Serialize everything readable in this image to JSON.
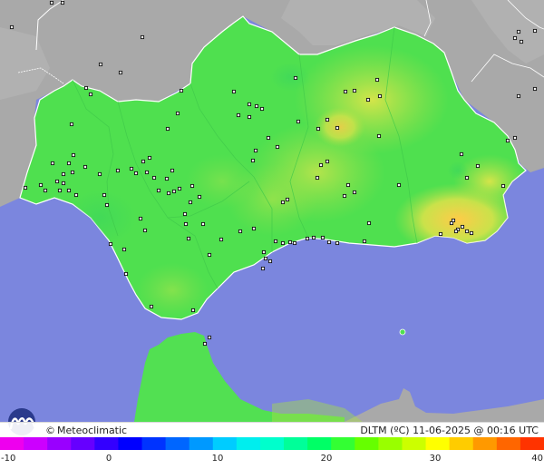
{
  "brand": {
    "copyright_symbol": "©",
    "name": "Meteoclimatic"
  },
  "info": {
    "variable": "DLTM",
    "unit": "(ºC)",
    "datetime": "11-06-2025 @ 00:16 UTC"
  },
  "legend": {
    "min": -10,
    "max": 40,
    "ticks": [
      "-10",
      "0",
      "10",
      "20",
      "30",
      "40"
    ],
    "colors": [
      "#ee00ee",
      "#cc00ff",
      "#9900ff",
      "#6600ff",
      "#3300ff",
      "#0000ff",
      "#0033ff",
      "#0066ff",
      "#0099ff",
      "#00ccff",
      "#00eeee",
      "#00ffcc",
      "#00ff99",
      "#00ff66",
      "#33ff33",
      "#66ff00",
      "#99ff00",
      "#ccff00",
      "#ffff00",
      "#ffcc00",
      "#ff9900",
      "#ff6600",
      "#ff3300"
    ]
  },
  "map_colors": {
    "sea": "#7b86de",
    "land_gray": "#a8a8a8",
    "andalusia": "#4fe04f",
    "africa": "#52e052",
    "warm": "#c9e34d",
    "hot": "#ffd24a",
    "border": "#ffffff",
    "station": "#111111"
  },
  "stations": [
    [
      57,
      3
    ],
    [
      69,
      3
    ],
    [
      13,
      30
    ],
    [
      157,
      41
    ],
    [
      111,
      71
    ],
    [
      133,
      80
    ],
    [
      95,
      97
    ],
    [
      100,
      104
    ],
    [
      200,
      100
    ],
    [
      258,
      101
    ],
    [
      275,
      115
    ],
    [
      283,
      117
    ],
    [
      263,
      127
    ],
    [
      275,
      129
    ],
    [
      289,
      120
    ],
    [
      196,
      125
    ],
    [
      185,
      142
    ],
    [
      79,
      137
    ],
    [
      81,
      171
    ],
    [
      76,
      180
    ],
    [
      58,
      180
    ],
    [
      70,
      192
    ],
    [
      94,
      184
    ],
    [
      80,
      190
    ],
    [
      63,
      200
    ],
    [
      66,
      210
    ],
    [
      70,
      202
    ],
    [
      76,
      210
    ],
    [
      45,
      204
    ],
    [
      28,
      207
    ],
    [
      50,
      210
    ],
    [
      84,
      215
    ],
    [
      110,
      192
    ],
    [
      115,
      215
    ],
    [
      130,
      188
    ],
    [
      145,
      186
    ],
    [
      150,
      191
    ],
    [
      158,
      178
    ],
    [
      162,
      190
    ],
    [
      165,
      174
    ],
    [
      170,
      196
    ],
    [
      184,
      197
    ],
    [
      190,
      188
    ],
    [
      192,
      211
    ],
    [
      186,
      213
    ],
    [
      175,
      210
    ],
    [
      198,
      208
    ],
    [
      210,
      223
    ],
    [
      212,
      205
    ],
    [
      220,
      217
    ],
    [
      155,
      241
    ],
    [
      160,
      254
    ],
    [
      204,
      236
    ],
    [
      205,
      247
    ],
    [
      208,
      263
    ],
    [
      224,
      247
    ],
    [
      231,
      281
    ],
    [
      244,
      264
    ],
    [
      265,
      255
    ],
    [
      280,
      252
    ],
    [
      291,
      278
    ],
    [
      293,
      285
    ],
    [
      298,
      288
    ],
    [
      290,
      296
    ],
    [
      304,
      266
    ],
    [
      312,
      268
    ],
    [
      320,
      267
    ],
    [
      325,
      268
    ],
    [
      339,
      263
    ],
    [
      346,
      262
    ],
    [
      356,
      262
    ],
    [
      363,
      267
    ],
    [
      372,
      268
    ],
    [
      402,
      266
    ],
    [
      407,
      246
    ],
    [
      384,
      204
    ],
    [
      391,
      212
    ],
    [
      380,
      216
    ],
    [
      354,
      182
    ],
    [
      361,
      178
    ],
    [
      350,
      196
    ],
    [
      312,
      223
    ],
    [
      317,
      220
    ],
    [
      282,
      166
    ],
    [
      279,
      177
    ],
    [
      296,
      152
    ],
    [
      306,
      162
    ],
    [
      329,
      134
    ],
    [
      326,
      86
    ],
    [
      351,
      142
    ],
    [
      361,
      132
    ],
    [
      372,
      141
    ],
    [
      381,
      101
    ],
    [
      391,
      100
    ],
    [
      416,
      88
    ],
    [
      419,
      106
    ],
    [
      406,
      110
    ],
    [
      418,
      150
    ],
    [
      509,
      170
    ],
    [
      515,
      196
    ],
    [
      527,
      183
    ],
    [
      560,
      155
    ],
    [
      568,
      152
    ],
    [
      555,
      205
    ],
    [
      572,
      35
    ],
    [
      568,
      42
    ],
    [
      575,
      46
    ],
    [
      590,
      34
    ],
    [
      572,
      106
    ],
    [
      590,
      98
    ],
    [
      440,
      204
    ],
    [
      498,
      246
    ],
    [
      500,
      243
    ],
    [
      505,
      253
    ],
    [
      510,
      250
    ],
    [
      515,
      255
    ],
    [
      520,
      257
    ],
    [
      503,
      255
    ],
    [
      486,
      258
    ],
    [
      137,
      275
    ],
    [
      139,
      302
    ],
    [
      122,
      269
    ],
    [
      167,
      338
    ],
    [
      213,
      342
    ],
    [
      231,
      372
    ],
    [
      226,
      379
    ],
    [
      118,
      226
    ]
  ]
}
